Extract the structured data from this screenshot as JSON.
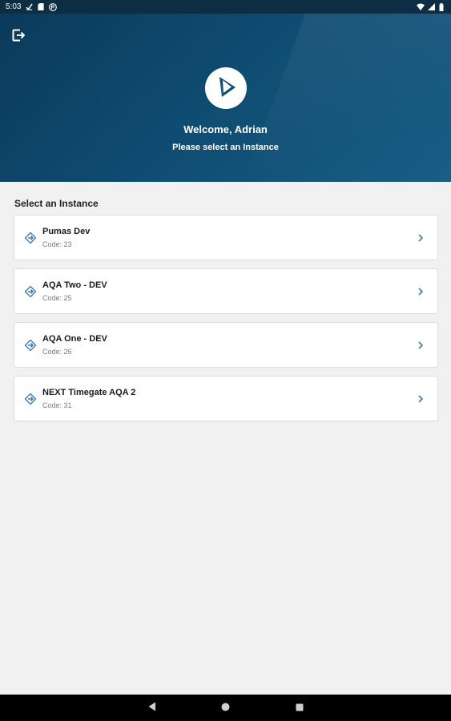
{
  "status_bar": {
    "time": "5:03",
    "left_icons": [
      "check-icon",
      "sim-icon",
      "app-icon"
    ],
    "right_icons": [
      "wifi-icon",
      "signal-icon",
      "battery-icon"
    ]
  },
  "header": {
    "exit_icon": "exit-icon",
    "logo_icon": "play-logo-icon",
    "welcome": "Welcome, Adrian",
    "subtitle": "Please select an Instance",
    "colors": {
      "gradient_start": "#0b3a5b",
      "gradient_end": "#1a5e85"
    }
  },
  "main": {
    "section_title": "Select an Instance",
    "instances": [
      {
        "name": "Pumas Dev",
        "code": "Code: 23"
      },
      {
        "name": "AQA Two - DEV",
        "code": "Code: 25"
      },
      {
        "name": "AQA One - DEV",
        "code": "Code: 26"
      },
      {
        "name": "NEXT Timegate AQA 2",
        "code": "Code: 31"
      }
    ],
    "item_icon": "instance-diamond-icon",
    "chevron_icon": "chevron-right-icon",
    "colors": {
      "accent": "#3d7ab8"
    }
  },
  "nav_bar": {
    "buttons": [
      "back-icon",
      "home-icon",
      "recents-icon"
    ]
  }
}
